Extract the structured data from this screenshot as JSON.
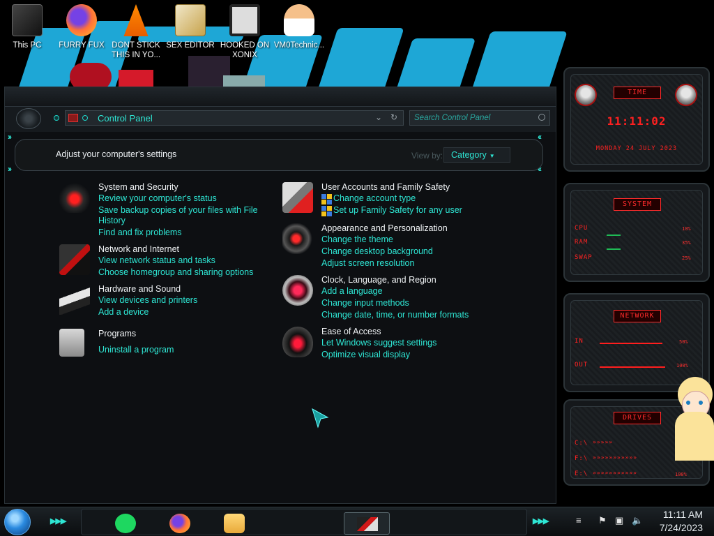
{
  "desktop": {
    "icons": [
      {
        "label": "This PC",
        "icon": "this-pc-icon"
      },
      {
        "label": "FURRY FUX",
        "icon": "firefox-icon"
      },
      {
        "label": "DONT STICK THIS IN YO...",
        "icon": "vlc-icon"
      },
      {
        "label": "SEX EDITOR",
        "icon": "hxd-editor-icon"
      },
      {
        "label": "HOOKED ON XONIX",
        "icon": "xonix-game-icon"
      },
      {
        "label": "VM0Technic...",
        "icon": "doctor-avatar-icon"
      }
    ]
  },
  "window": {
    "address": "Control Panel",
    "search_placeholder": "Search Control Panel",
    "header": "Adjust your computer's settings",
    "view_by_label": "View by:",
    "view_by_value": "Category"
  },
  "categories_left": [
    {
      "title": "System and Security",
      "links": [
        "Review your computer's status",
        "Save backup copies of your files with File",
        "History",
        "Find and fix problems"
      ]
    },
    {
      "title": "Network and Internet",
      "links": [
        "View network status and tasks",
        "Choose homegroup and sharing options"
      ]
    },
    {
      "title": "Hardware and Sound",
      "links": [
        "View devices and printers",
        "Add a device"
      ]
    },
    {
      "title": "Programs",
      "links": [
        "Uninstall a program"
      ]
    }
  ],
  "categories_right": [
    {
      "title": "User Accounts and Family Safety",
      "links": [
        "Change account type",
        "Set up Family Safety for any user"
      ]
    },
    {
      "title": "Appearance and Personalization",
      "links": [
        "Change the theme",
        "Change desktop background",
        "Adjust screen resolution"
      ]
    },
    {
      "title": "Clock, Language, and Region",
      "links": [
        "Add a language",
        "Change input methods",
        "Change date, time, or number formats"
      ]
    },
    {
      "title": "Ease of Access",
      "links": [
        "Let Windows suggest settings",
        "Optimize visual display"
      ]
    }
  ],
  "gadgets": {
    "time": {
      "title": "TIME",
      "clock": "11:11:02",
      "date": "MONDAY 24 JULY 2023"
    },
    "system": {
      "title": "SYSTEM",
      "rows": [
        {
          "label": "CPU",
          "value": "10%",
          "level": 0.1
        },
        {
          "label": "RAM",
          "value": "35%",
          "level": 0.35
        },
        {
          "label": "SWAP",
          "value": "25%",
          "level": 0.25
        }
      ]
    },
    "network": {
      "title": "NETWORK",
      "rows": [
        {
          "label": "IN",
          "value": "50%"
        },
        {
          "label": "OUT",
          "value": "100%"
        }
      ]
    },
    "drives": {
      "title": "DRIVES",
      "rows": [
        {
          "label": "C:\\",
          "value": ""
        },
        {
          "label": "F:\\",
          "value": "100%"
        },
        {
          "label": "E:\\",
          "value": "100%"
        }
      ]
    }
  },
  "taskbar": {
    "time": "11:11 AM",
    "date": "7/24/2023",
    "apps": [
      "spotify-icon",
      "firefox-icon",
      "file-explorer-icon",
      "control-panel-icon"
    ]
  },
  "colors": {
    "accent": "#2ee6d4",
    "gadget_red": "#ff2222",
    "window_bg": "#0d0f12"
  }
}
